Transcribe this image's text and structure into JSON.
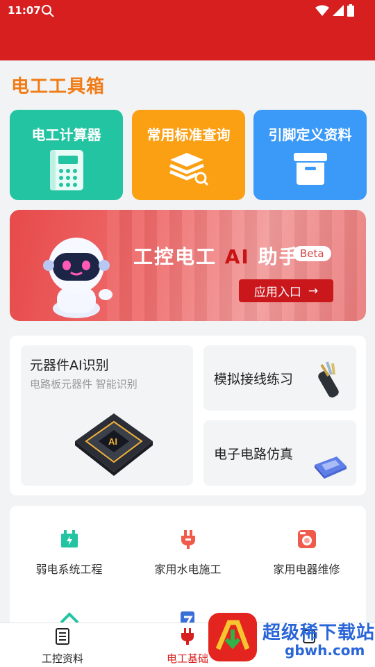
{
  "status": {
    "time": "11:07"
  },
  "page_title": "电工工具箱",
  "cards": [
    {
      "label": "电工计算器",
      "icon": "calculator-icon"
    },
    {
      "label": "常用标准查询",
      "icon": "layers-search-icon"
    },
    {
      "label": "引脚定义资料",
      "icon": "box-icon"
    }
  ],
  "banner": {
    "title_part1": "工控电工 ",
    "title_ai": "AI",
    "title_part2": " 助手",
    "beta": "Beta",
    "enter": "应用入口",
    "enter_arrow": "→"
  },
  "features": {
    "ai_title": "元器件AI识别",
    "ai_sub": "电路板元器件 智能识别",
    "wire": "模拟接线练习",
    "sim": "电子电路仿真"
  },
  "grid": [
    {
      "label": "弱电系统工程",
      "icon": "weak-current-icon"
    },
    {
      "label": "家用水电施工",
      "icon": "plug-icon"
    },
    {
      "label": "家用电器维修",
      "icon": "washer-icon"
    }
  ],
  "nav": [
    {
      "label": "工控资料",
      "icon": "document-icon"
    },
    {
      "label": "电工基础",
      "icon": "plug-nav-icon"
    },
    {
      "label": "",
      "icon": "tools-icon"
    }
  ],
  "watermark": {
    "line1": "超级稀下载站",
    "line2": "gbwh.com"
  },
  "colors": {
    "header": "#d71f1f",
    "title": "#f07c16",
    "calc": "#23c4a1",
    "std": "#fb9f13",
    "pin": "#3b9af7",
    "nav_active": "#d71f1f"
  }
}
